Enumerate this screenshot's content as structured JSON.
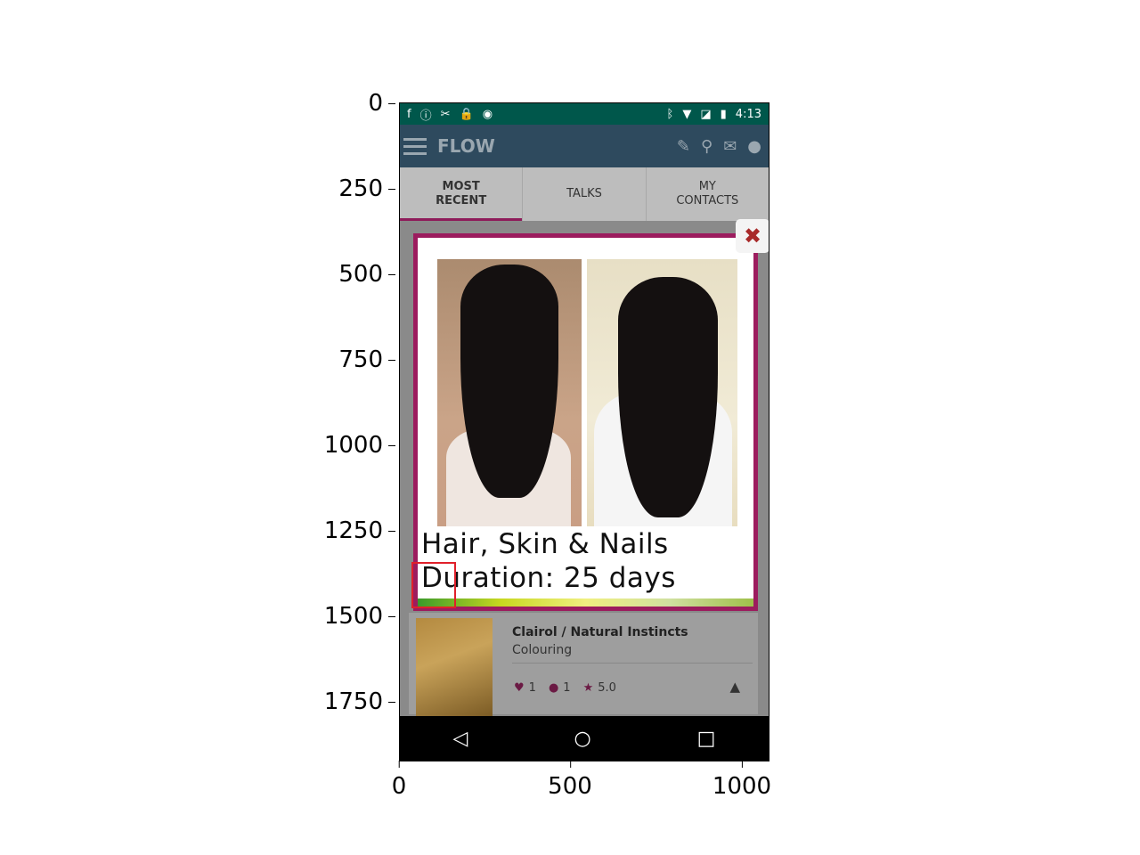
{
  "figure": {
    "y_ticks": [
      "0",
      "250",
      "500",
      "750",
      "1000",
      "1250",
      "1500",
      "1750"
    ],
    "x_ticks": [
      "0",
      "500",
      "1000"
    ]
  },
  "status_bar": {
    "time": "4:13",
    "left_icons": [
      "facebook-icon",
      "alert-icon",
      "tools-icon",
      "lock-icon",
      "android-icon"
    ],
    "right_icons": [
      "bluetooth-icon",
      "wifi-icon",
      "no-sim-icon",
      "battery-icon"
    ]
  },
  "app_bar": {
    "title": "FLOW",
    "actions": [
      "edit-icon",
      "search-icon",
      "mail-icon",
      "chat-icon"
    ]
  },
  "tabs": [
    {
      "label": "MOST\nRECENT",
      "active": true
    },
    {
      "label": "TALKS",
      "active": false
    },
    {
      "label": "MY\nCONTACTS",
      "active": false
    }
  ],
  "modal": {
    "caption_line1": "Hair, Skin & Nails",
    "caption_line2": "Duration: 25 days",
    "close_icon": "close-icon",
    "border_color": "#9c1c5e"
  },
  "card": {
    "product": "Clairol / Natural Instincts",
    "category": "Colouring",
    "likes": "1",
    "comments": "1",
    "rating": "5.0"
  },
  "nav_bar": {
    "back": "◁",
    "home": "○",
    "recents": "□"
  },
  "colors": {
    "status_bar": "#00574B",
    "app_bar": "#2e4a5e",
    "accent": "#8e1b5a",
    "highlight": "#e0202a"
  }
}
